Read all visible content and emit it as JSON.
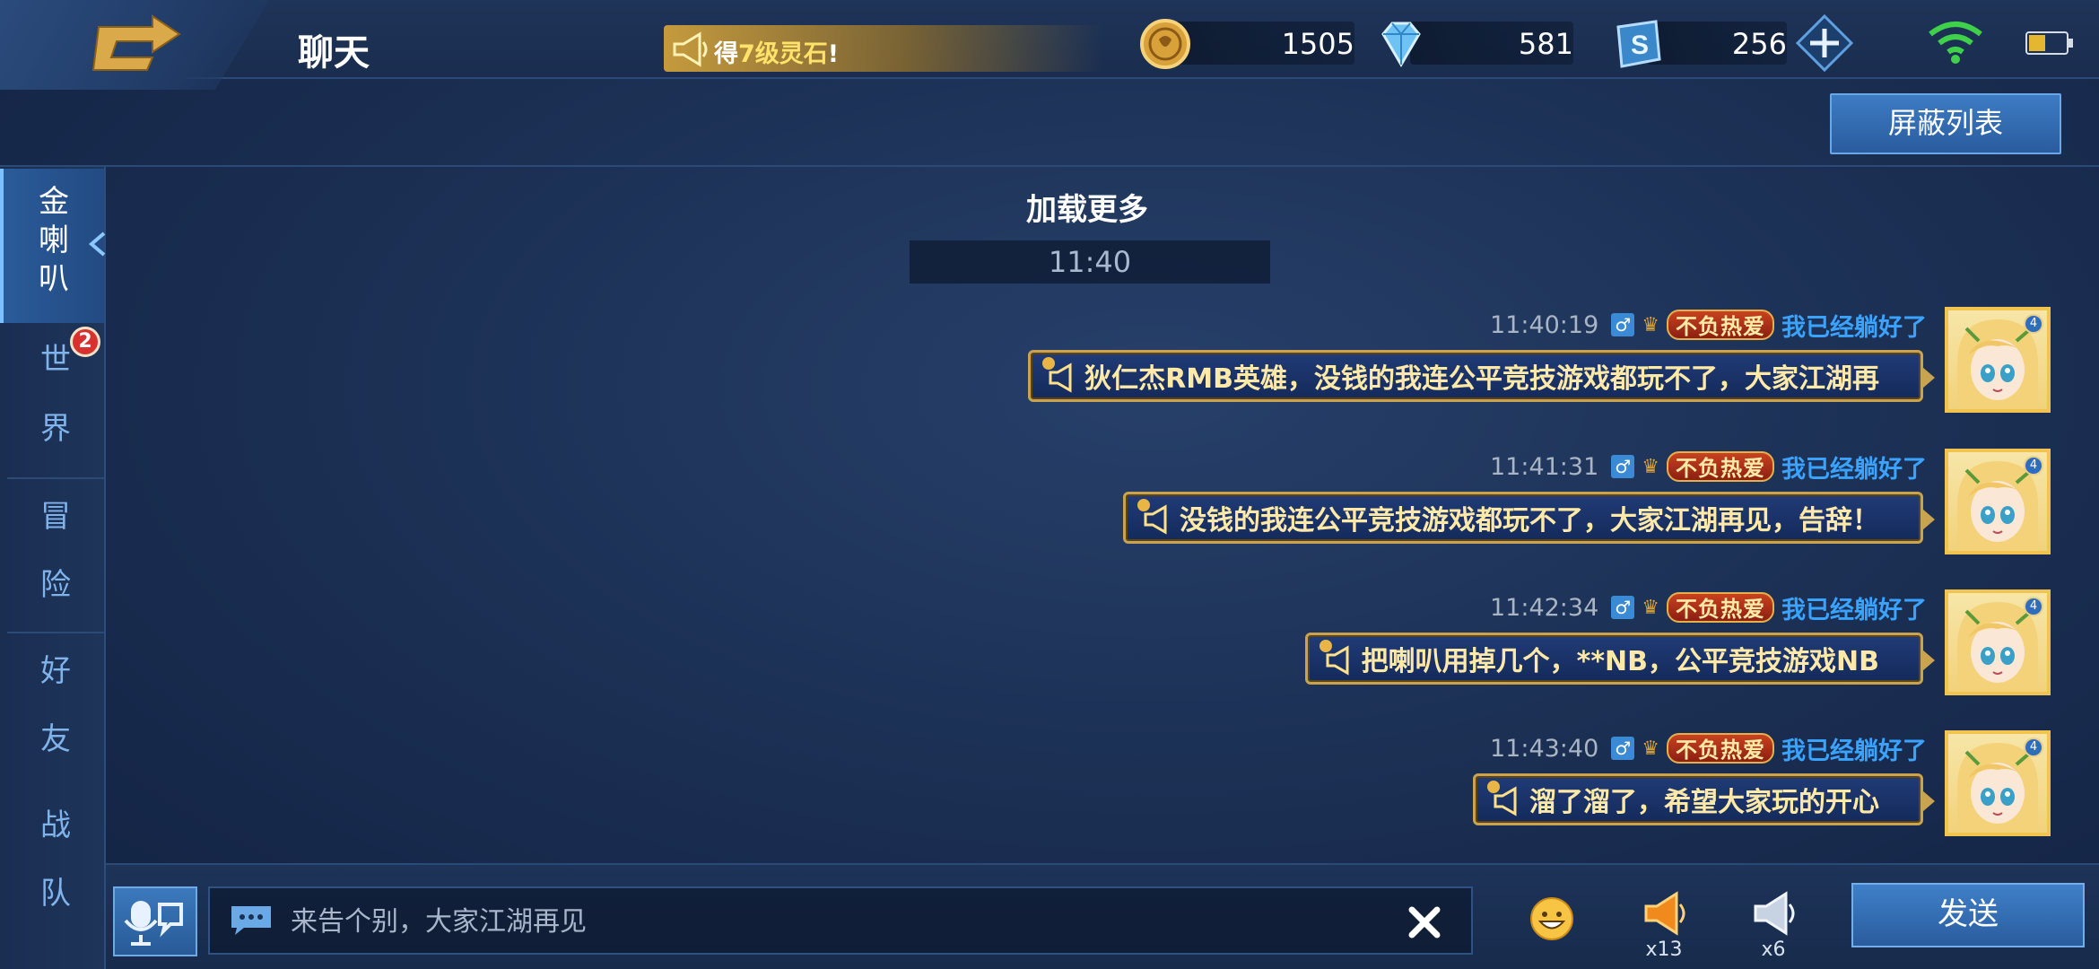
{
  "header": {
    "title": "聊天",
    "promo_prefix": "得",
    "promo_highlight": "7级灵石",
    "promo_suffix": "!",
    "gold": "1505",
    "diamonds": "581",
    "vouchers": "256"
  },
  "toolbar": {
    "block_list_label": "屏蔽列表"
  },
  "sidebar": {
    "tabs": [
      {
        "label": "金喇叭",
        "chars": [
          "金",
          "喇",
          "叭"
        ],
        "active": true
      },
      {
        "label": "世界",
        "chars": [
          "世",
          "界"
        ],
        "badge": "2"
      },
      {
        "label": "冒险",
        "chars": [
          "冒",
          "险"
        ]
      },
      {
        "label": "好友",
        "chars": [
          "好",
          "友"
        ]
      },
      {
        "label": "战队",
        "chars": [
          "战",
          "队"
        ]
      }
    ]
  },
  "chat": {
    "load_more": "加载更多",
    "time_divider": "11:40",
    "messages": [
      {
        "time": "11:40:19",
        "gender": "♂",
        "title": "不负热爱",
        "name": "我已经躺好了",
        "text": "狄仁杰RMB英雄，没钱的我连公平竞技游戏都玩不了，大家江湖再",
        "avatar_level": "4"
      },
      {
        "time": "11:41:31",
        "gender": "♂",
        "title": "不负热爱",
        "name": "我已经躺好了",
        "text": "没钱的我连公平竞技游戏都玩不了，大家江湖再见，告辞！",
        "avatar_level": "4"
      },
      {
        "time": "11:42:34",
        "gender": "♂",
        "title": "不负热爱",
        "name": "我已经躺好了",
        "text": "把喇叭用掉几个，**NB，公平竞技游戏NB",
        "avatar_level": "4"
      },
      {
        "time": "11:43:40",
        "gender": "♂",
        "title": "不负热爱",
        "name": "我已经躺好了",
        "text": "溜了溜了，希望大家玩的开心",
        "avatar_level": "4"
      }
    ]
  },
  "input": {
    "placeholder": "来告个别，大家江湖再见",
    "gold_horn_count": "x13",
    "silver_horn_count": "x6",
    "send_label": "发送"
  },
  "colors": {
    "accent_blue": "#3aa3ff",
    "bubble_gold": "#c9a34f",
    "bubble_text": "#ffe9a8"
  }
}
